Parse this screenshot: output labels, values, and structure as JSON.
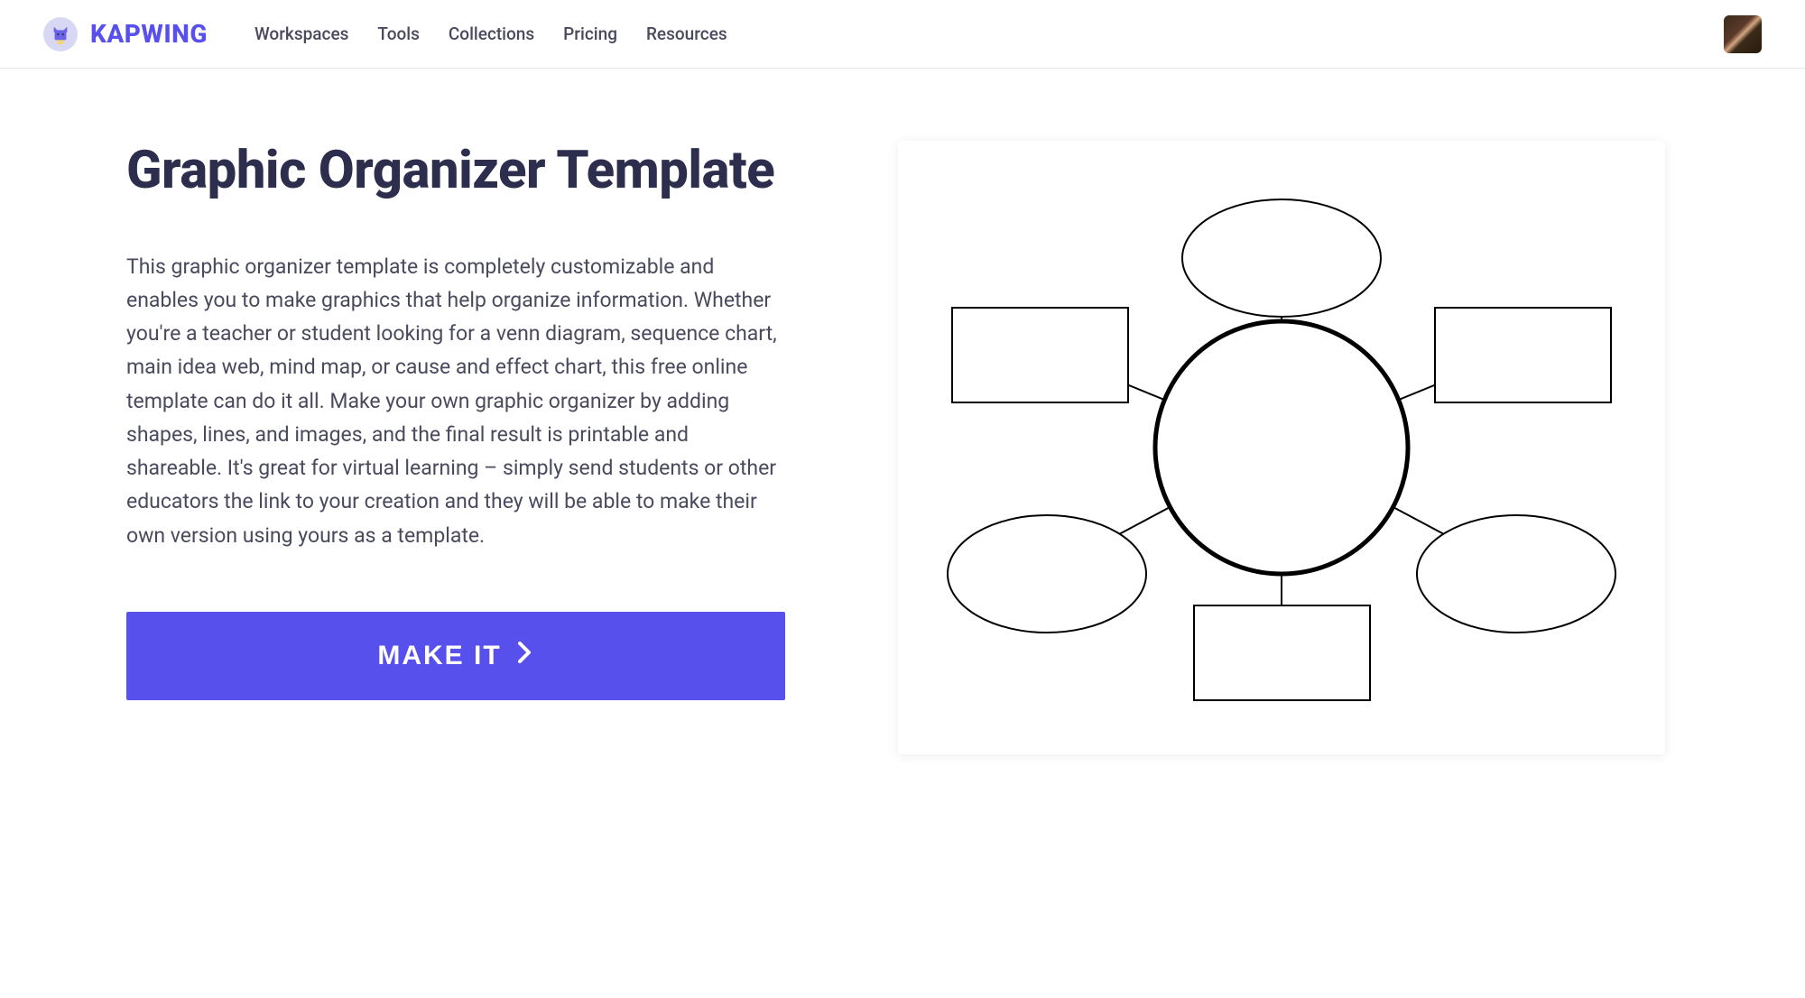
{
  "header": {
    "brand": "KAPWING",
    "nav": {
      "workspaces": "Workspaces",
      "tools": "Tools",
      "collections": "Collections",
      "pricing": "Pricing",
      "resources": "Resources"
    }
  },
  "page": {
    "title": "Graphic Organizer Template",
    "description": "This graphic organizer template is completely customizable and enables you to make graphics that help organize information. Whether you're a teacher or student looking for a venn diagram, sequence chart, main idea web, mind map, or cause and effect chart, this free online template can do it all. Make your own graphic organizer by adding shapes, lines, and images, and the final result is printable and shareable. It's great for virtual learning – simply send students or other educators the link to your creation and they will be able to make their own version using yours as a template.",
    "cta_label": "MAKE IT"
  }
}
